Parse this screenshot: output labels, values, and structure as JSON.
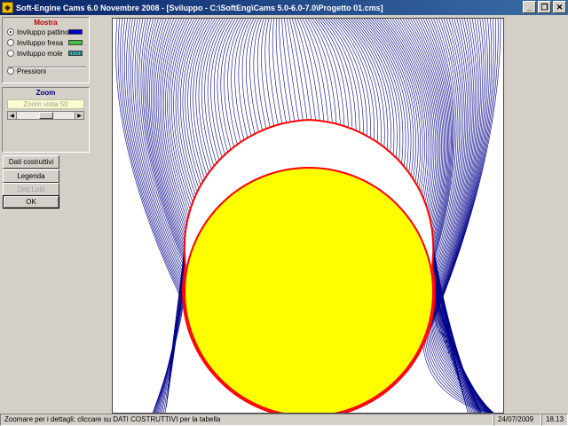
{
  "window": {
    "title": "Soft-Engine Cams 6.0   Novembre 2008 - [Sviluppo - C:\\SoftEng\\Cams 5.0-6.0-7.0\\Progetto 01.cms]",
    "minimize_icon": "minimize-icon",
    "restore_icon": "restore-icon",
    "close_icon": "close-icon"
  },
  "mostra": {
    "title": "Mostra",
    "options": [
      {
        "label": "Inviluppo pattino",
        "checked": true,
        "color": "#0000cc"
      },
      {
        "label": "Inviluppo fresa",
        "checked": false,
        "color": "#40c040"
      },
      {
        "label": "Inviluppo mole",
        "checked": false,
        "color": "#208080"
      }
    ],
    "pressioni": {
      "label": "Pressioni",
      "checked": false
    }
  },
  "zoom": {
    "title": "Zoom",
    "readout": "Zoom vista  50",
    "value_fraction": 0.5
  },
  "buttons": {
    "dati_costruttivi": "Dati costruttivi",
    "legenda": "Legenda",
    "dist_lobi": "Dist.Lobi",
    "ok": "OK"
  },
  "status": {
    "message": "Zoomare per i dettagli: cliccare su DATI COSTRUTTIVI per la tabella",
    "date": "24/07/2009",
    "time": "18.13"
  },
  "colors": {
    "envelope": "#00008b",
    "cam_outline": "#ff0000",
    "base_circle_fill": "#ffff00"
  }
}
